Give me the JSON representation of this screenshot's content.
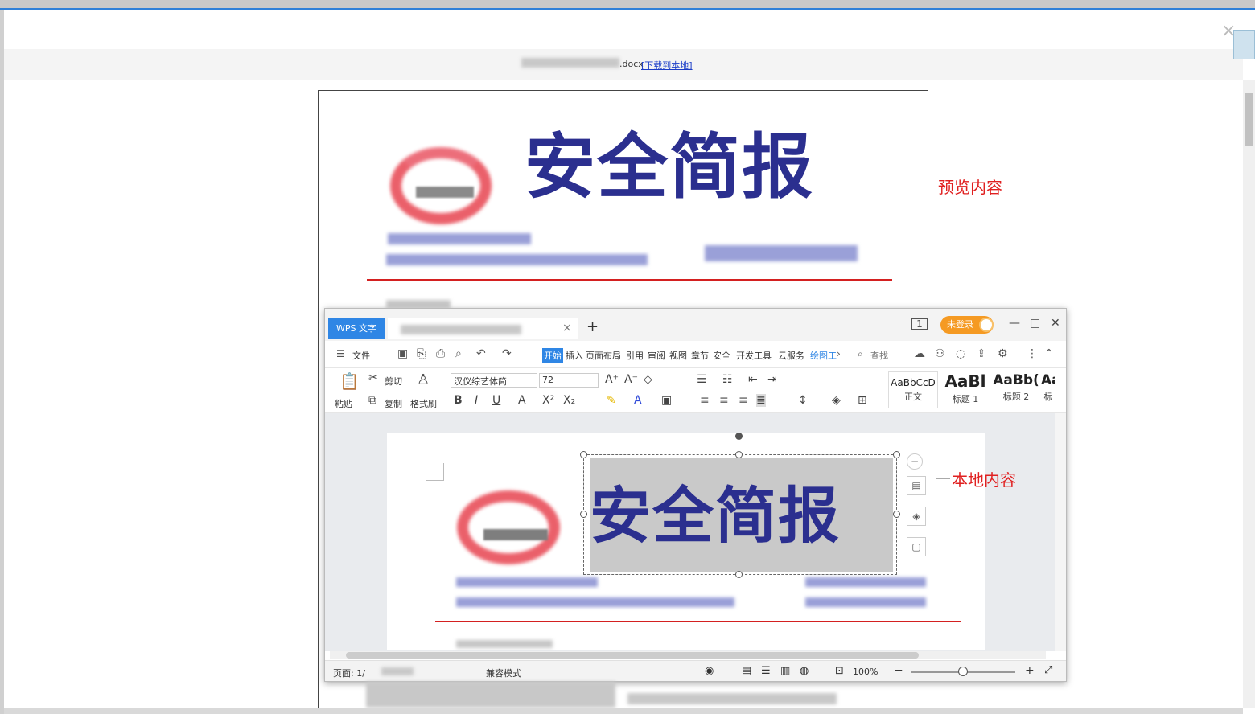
{
  "viewer": {
    "file_ext": ".docx",
    "download_link": "[下载到本地]",
    "close_glyph": "×"
  },
  "preview": {
    "title": "安全简报",
    "annotation": "预览内容"
  },
  "local": {
    "annotation": "本地内容",
    "title": "安全简报"
  },
  "wps": {
    "app_tab": "WPS 文字",
    "new_tab": "+",
    "tab_close": "×",
    "login": "未登录",
    "menu": [
      "文件",
      "开始",
      "插入",
      "页面布局",
      "引用",
      "审阅",
      "视图",
      "章节",
      "安全",
      "开发工具",
      "云服务",
      "绘图工",
      "查找"
    ],
    "ribbon": {
      "paste": "粘贴",
      "cut": "剪切",
      "copy": "复制",
      "format_painter": "格式刷",
      "font": "汉仪综艺体简",
      "size": "72",
      "styles": [
        {
          "sample": "AaBbCcD",
          "name": "正文"
        },
        {
          "sample": "AaBl",
          "name": "标题 1"
        },
        {
          "sample": "AaBb(",
          "name": "标题 2"
        },
        {
          "sample": "Aa",
          "name": "标"
        }
      ]
    },
    "status": {
      "page": "页面: 1/",
      "mode": "兼容模式",
      "zoom": "100%",
      "zoom_minus": "−",
      "zoom_plus": "+"
    }
  },
  "colors": {
    "accent_blue": "#2f86e5",
    "title_navy": "#2b2f8f",
    "annotation_red": "#e02020",
    "login_orange": "#f59a23"
  }
}
